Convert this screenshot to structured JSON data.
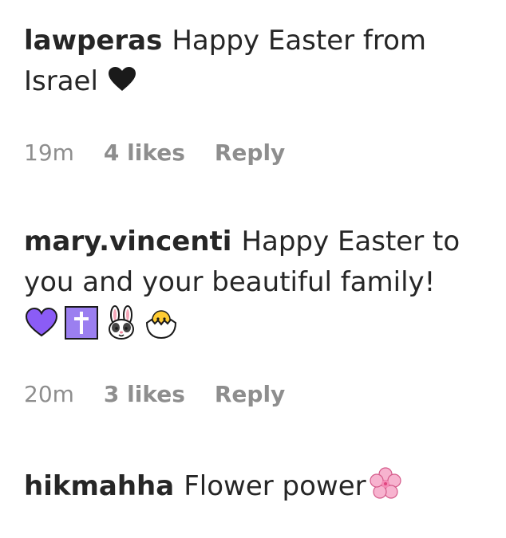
{
  "comments": [
    {
      "username": "lawperas",
      "text": "Happy Easter from Israel",
      "emojis": [
        "black-heart-icon"
      ],
      "time": "19m",
      "likes": "4 likes",
      "reply": "Reply"
    },
    {
      "username": "mary.vincenti",
      "text": "Happy Easter to you and your beautiful family!",
      "emojis": [
        "purple-heart-icon",
        "latin-cross-icon",
        "rabbit-face-icon",
        "hatching-chick-icon"
      ],
      "time": "20m",
      "likes": "3 likes",
      "reply": "Reply"
    },
    {
      "username": "hikmahha",
      "text": "Flower power",
      "emojis": [
        "cherry-blossom-icon"
      ]
    }
  ],
  "colors": {
    "text": "#262626",
    "meta": "#8e8e8e",
    "purple": "#8b5cf6"
  }
}
